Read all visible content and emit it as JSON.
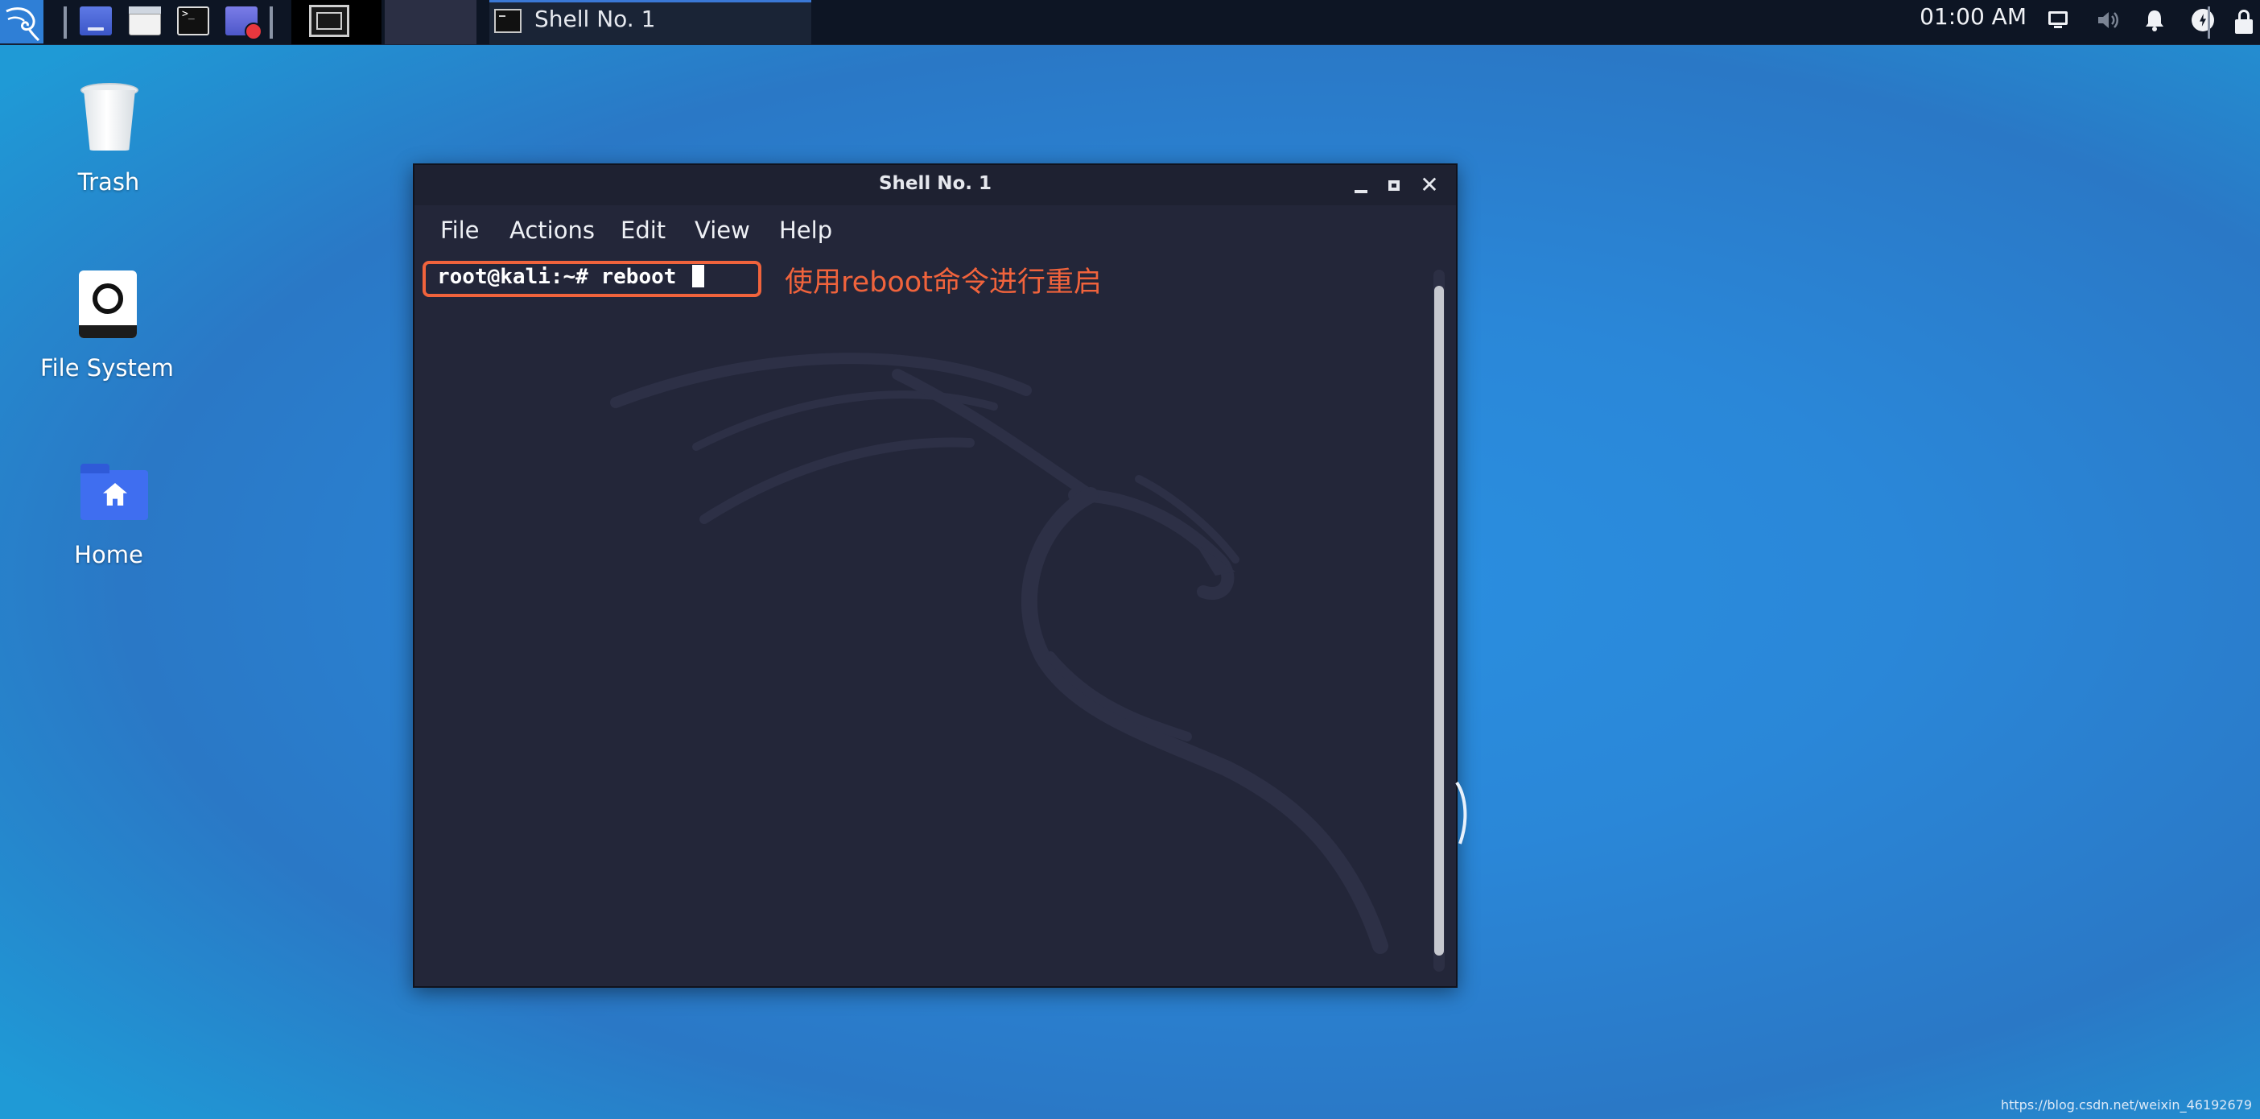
{
  "taskbar": {
    "task_title": "Shell No. 1",
    "clock": "01:00 AM",
    "icons": {
      "menu": "kali-dragon-icon",
      "desktop": "show-desktop-icon",
      "files": "file-manager-icon",
      "terminal": "terminal-icon",
      "recorder": "screen-recorder-icon",
      "display": "display-icon",
      "volume": "volume-icon",
      "notifications": "bell-icon",
      "power": "power-icon",
      "lock": "lock-icon"
    }
  },
  "desktop": {
    "icons": [
      {
        "label": "Trash"
      },
      {
        "label": "File System"
      },
      {
        "label": "Home"
      }
    ]
  },
  "window": {
    "title": "Shell No. 1",
    "menu": [
      "File",
      "Actions",
      "Edit",
      "View",
      "Help"
    ],
    "terminal": {
      "prompt": "root@kali:~#",
      "command": "reboot"
    }
  },
  "annotation": {
    "text": "使用reboot命令进行重启",
    "color": "#f0633c"
  },
  "watermark": "https://blog.csdn.net/weixin_46192679",
  "colors": {
    "terminal_bg": "#232639",
    "taskbar_bg": "#0d1524",
    "desktop_blue": "#2a87d8",
    "accent": "#3a78d6"
  }
}
